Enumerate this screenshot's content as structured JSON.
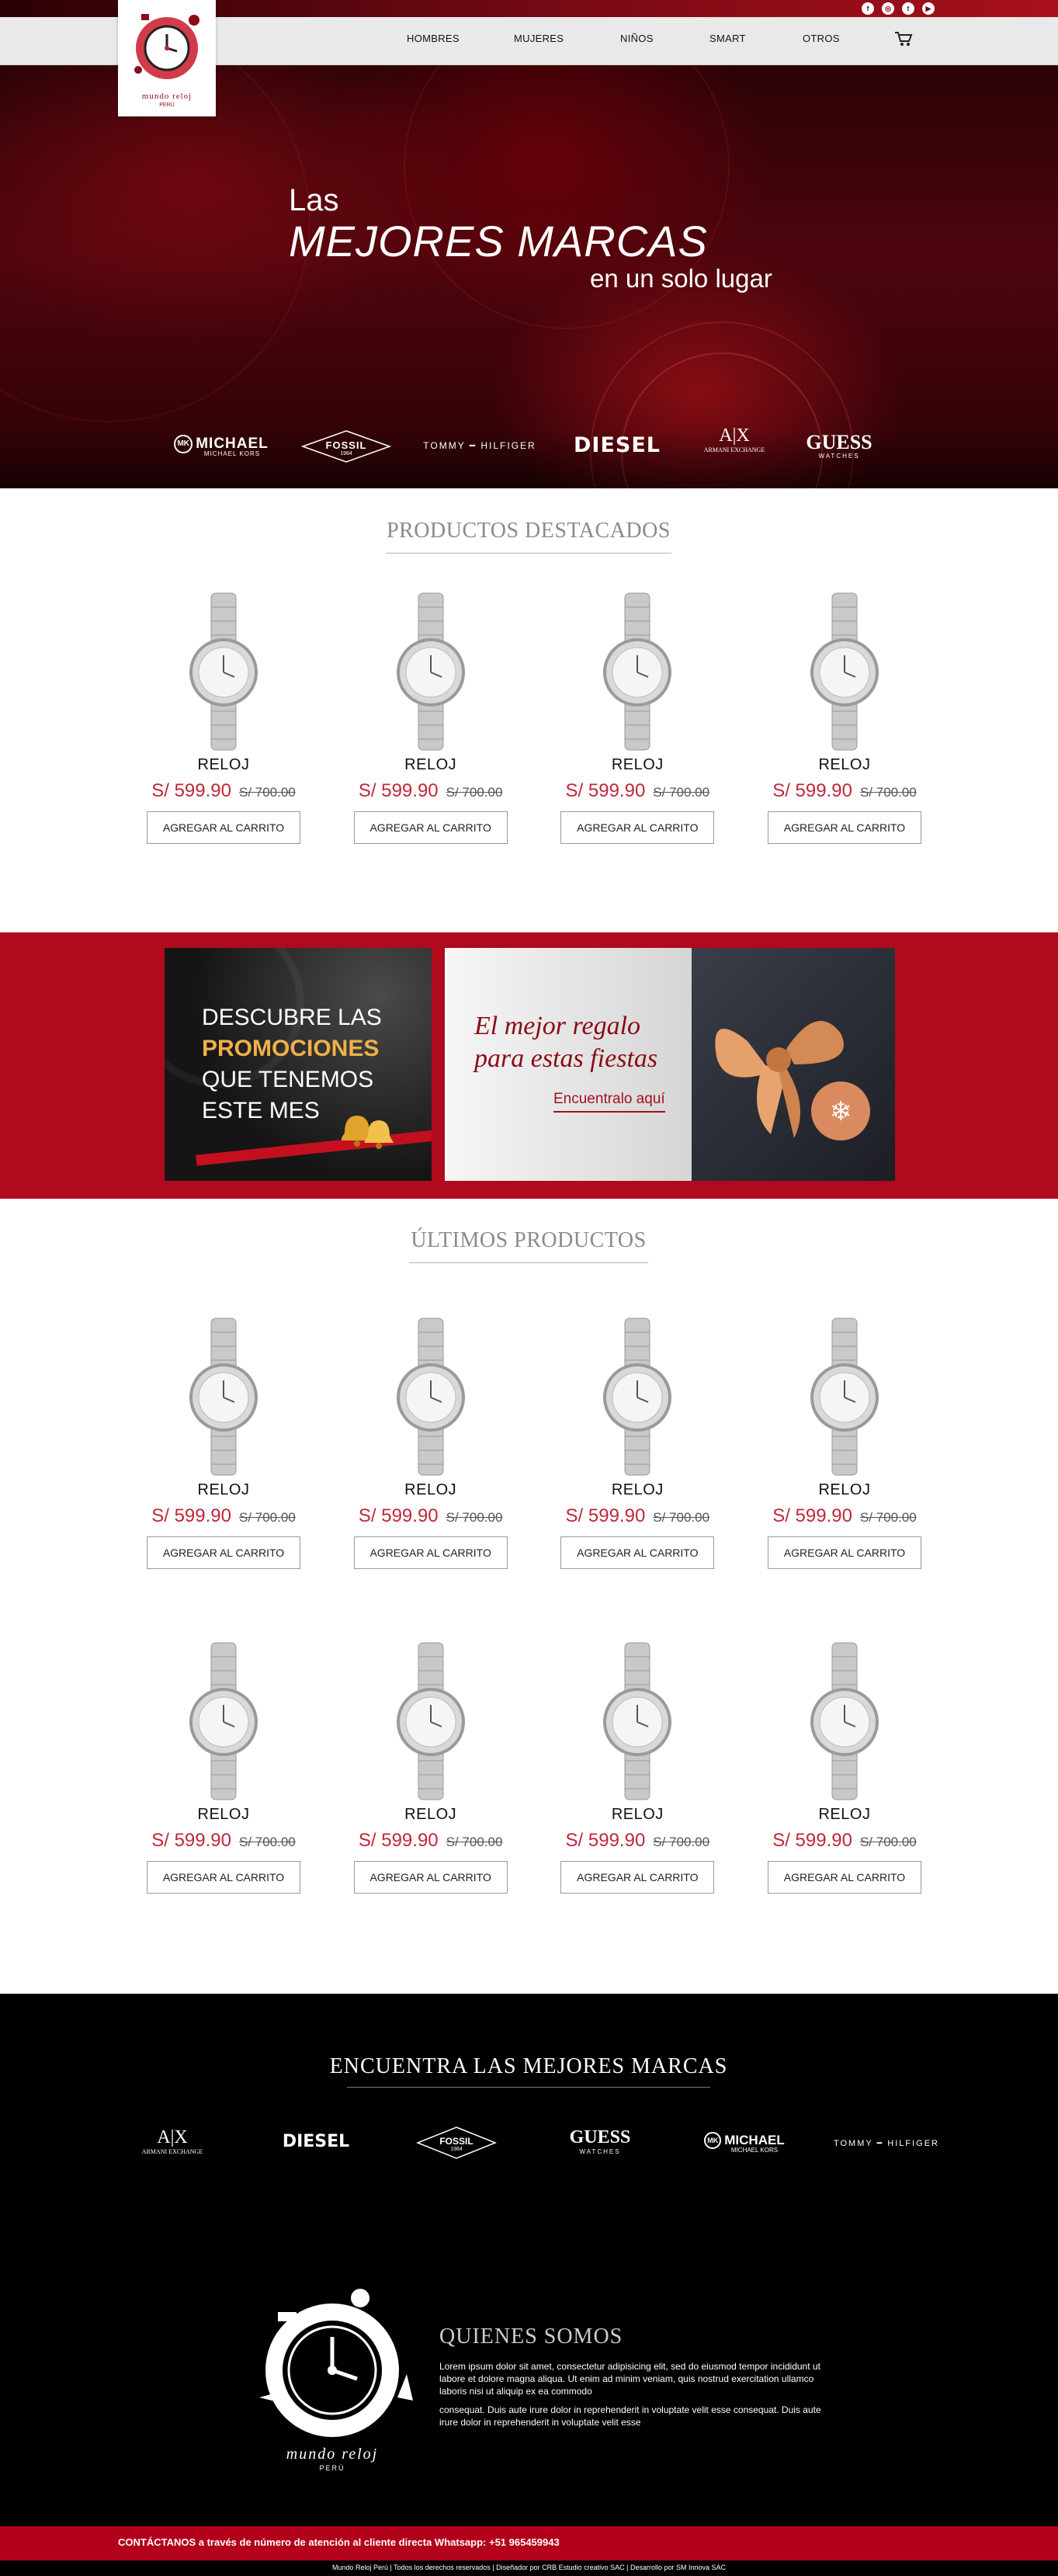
{
  "header": {
    "logo_text": "mundo reloj",
    "logo_sub": "PERÚ",
    "nav": [
      "HOMBRES",
      "MUJERES",
      "NIÑOS",
      "SMART",
      "OTROS"
    ],
    "social": [
      "f",
      "◎",
      "t",
      "▶"
    ]
  },
  "hero": {
    "line1": "Las",
    "line2": "MEJORES MARCAS",
    "line3": "en un solo lugar",
    "brands": {
      "mk_name": "MICHAEL",
      "mk_sub": "MICHAEL KORS",
      "fossil": "FOSSIL",
      "fossil_sub": "1984",
      "tommy": "TOMMY ━ HILFIGER",
      "diesel": "DIESEL",
      "ax": "A|X",
      "ax_sub": "ARMANI EXCHANGE",
      "guess": "GUESS",
      "guess_sub": "WATCHES"
    }
  },
  "featured": {
    "title": "PRODUCTOS DESTACADOS",
    "products": [
      {
        "name": "RELOJ",
        "price": "S/ 599.90",
        "old_price": "S/ 700.00",
        "button": "AGREGAR AL CARRITO"
      },
      {
        "name": "RELOJ",
        "price": "S/ 599.90",
        "old_price": "S/ 700.00",
        "button": "AGREGAR AL CARRITO"
      },
      {
        "name": "RELOJ",
        "price": "S/ 599.90",
        "old_price": "S/ 700.00",
        "button": "AGREGAR AL CARRITO"
      },
      {
        "name": "RELOJ",
        "price": "S/ 599.90",
        "old_price": "S/ 700.00",
        "button": "AGREGAR AL CARRITO"
      }
    ]
  },
  "promos": {
    "p1_line1": "DESCUBRE LAS",
    "p1_line2": "PROMOCIONES",
    "p1_line3": "QUE TENEMOS",
    "p1_line4": "ESTE MES",
    "p2_line1": "El mejor regalo",
    "p2_line2": "para estas fiestas",
    "p2_link": "Encuentralo aquí"
  },
  "latest": {
    "title": "ÚLTIMOS PRODUCTOS",
    "products": [
      {
        "name": "RELOJ",
        "price": "S/ 599.90",
        "old_price": "S/ 700.00",
        "button": "AGREGAR AL CARRITO"
      },
      {
        "name": "RELOJ",
        "price": "S/ 599.90",
        "old_price": "S/ 700.00",
        "button": "AGREGAR AL CARRITO"
      },
      {
        "name": "RELOJ",
        "price": "S/ 599.90",
        "old_price": "S/ 700.00",
        "button": "AGREGAR AL CARRITO"
      },
      {
        "name": "RELOJ",
        "price": "S/ 599.90",
        "old_price": "S/ 700.00",
        "button": "AGREGAR AL CARRITO"
      },
      {
        "name": "RELOJ",
        "price": "S/ 599.90",
        "old_price": "S/ 700.00",
        "button": "AGREGAR AL CARRITO"
      },
      {
        "name": "RELOJ",
        "price": "S/ 599.90",
        "old_price": "S/ 700.00",
        "button": "AGREGAR AL CARRITO"
      },
      {
        "name": "RELOJ",
        "price": "S/ 599.90",
        "old_price": "S/ 700.00",
        "button": "AGREGAR AL CARRITO"
      },
      {
        "name": "RELOJ",
        "price": "S/ 599.90",
        "old_price": "S/ 700.00",
        "button": "AGREGAR AL CARRITO"
      }
    ]
  },
  "brands_section": {
    "title": "ENCUENTRA LAS MEJORES MARCAS"
  },
  "about": {
    "title": "QUIENES SOMOS",
    "p1": "Lorem ipsum dolor sit amet, consectetur adipisicing elit, sed do eiusmod tempor incididunt ut labore et dolore magna aliqua. Ut enim ad minim veniam, quis nostrud exercitation ullamco laboris nisi ut aliquip ex ea commodo",
    "p2": "consequat. Duis aute irure dolor in reprehenderit in voluptate velit esse consequat. Duis aute irure dolor in reprehenderit in voluptate velit esse",
    "logo_text": "mundo reloj",
    "logo_sub": "PERÚ"
  },
  "contact": {
    "text": "CONTÁCTANOS a través de número de atención al cliente directa Whatsapp: +51 965459943"
  },
  "bottom": {
    "text": "Mundo Reloj Perú | Todos los derechos reservados | Diseñador por CRB Estudio creativo SAC | Desarrollo por SM Innova SAC"
  },
  "colors": {
    "brand_red": "#b00a1d",
    "price_red": "#c0273a",
    "footer_black": "#000000"
  }
}
